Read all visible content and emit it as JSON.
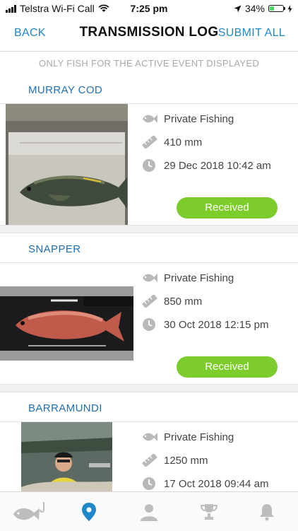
{
  "status_bar": {
    "carrier": "Telstra Wi-Fi Call",
    "time": "7:25 pm",
    "battery_percent": "34%",
    "battery_level": 0.34
  },
  "header": {
    "back_label": "BACK",
    "title": "TRANSMISSION LOG",
    "submit_label": "SUBMIT ALL"
  },
  "notice": "ONLY FISH FOR THE ACTIVE EVENT DISPLAYED",
  "entries": [
    {
      "species": "MURRAY COD",
      "fishing_type": "Private Fishing",
      "length": "410 mm",
      "datetime": "29 Dec 2018 10:42 am",
      "status": "Received"
    },
    {
      "species": "SNAPPER",
      "fishing_type": "Private Fishing",
      "length": "850 mm",
      "datetime": "30 Oct 2018 12:15 pm",
      "status": "Received"
    },
    {
      "species": "BARRAMUNDI",
      "fishing_type": "Private Fishing",
      "length": "1250 mm",
      "datetime": "17 Oct 2018 09:44 am"
    }
  ],
  "tabs": [
    {
      "icon": "fish-hook-icon"
    },
    {
      "icon": "map-pin-icon",
      "active": true
    },
    {
      "icon": "user-icon"
    },
    {
      "icon": "trophy-icon"
    },
    {
      "icon": "bell-icon"
    }
  ],
  "colors": {
    "accent": "#1e88c8",
    "title_blue": "#1e6fb5",
    "status_green": "#7ccd2c",
    "icon_grey": "#b9b9b9"
  }
}
